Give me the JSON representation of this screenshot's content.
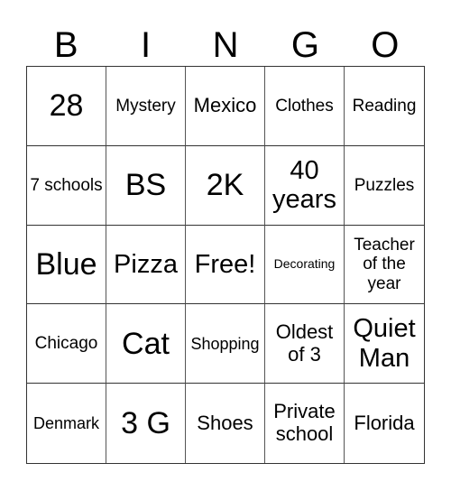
{
  "header": [
    "B",
    "I",
    "N",
    "G",
    "O"
  ],
  "cells": [
    {
      "text": "28",
      "size": "s-xl"
    },
    {
      "text": "Mystery",
      "size": "s-s"
    },
    {
      "text": "Mexico",
      "size": "s-m"
    },
    {
      "text": "Clothes",
      "size": "s-s"
    },
    {
      "text": "Reading",
      "size": "s-s"
    },
    {
      "text": "7 schools",
      "size": "s-s"
    },
    {
      "text": "BS",
      "size": "s-xl"
    },
    {
      "text": "2K",
      "size": "s-xl"
    },
    {
      "text": "40 years",
      "size": "s-l"
    },
    {
      "text": "Puzzles",
      "size": "s-s"
    },
    {
      "text": "Blue",
      "size": "s-xl"
    },
    {
      "text": "Pizza",
      "size": "s-l"
    },
    {
      "text": "Free!",
      "size": "s-l"
    },
    {
      "text": "Decorating",
      "size": "s-xxs"
    },
    {
      "text": "Teacher of the year",
      "size": "s-s"
    },
    {
      "text": "Chicago",
      "size": "s-s"
    },
    {
      "text": "Cat",
      "size": "s-xl"
    },
    {
      "text": "Shopping",
      "size": "s-xs"
    },
    {
      "text": "Oldest of 3",
      "size": "s-m"
    },
    {
      "text": "Quiet Man",
      "size": "s-l"
    },
    {
      "text": "Denmark",
      "size": "s-xs"
    },
    {
      "text": "3 G",
      "size": "s-xl"
    },
    {
      "text": "Shoes",
      "size": "s-m"
    },
    {
      "text": "Private school",
      "size": "s-m"
    },
    {
      "text": "Florida",
      "size": "s-m"
    }
  ]
}
